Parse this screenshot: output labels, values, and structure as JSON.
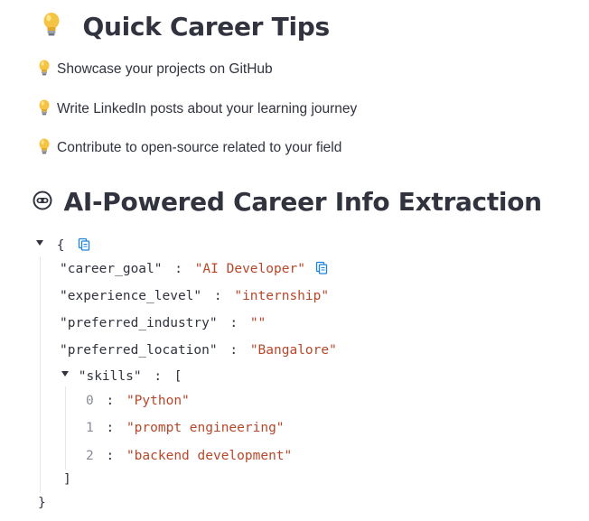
{
  "tips_section": {
    "title": "Quick Career Tips",
    "icon": "lightbulb-icon",
    "items": [
      "Showcase your projects on GitHub",
      "Write LinkedIn posts about your learning journey",
      "Contribute to open-source related to your field"
    ]
  },
  "extraction_section": {
    "title": "AI-Powered Career Info Extraction",
    "icon": "robot-face-icon"
  },
  "json_view": {
    "open_brace": "{",
    "close_brace": "}",
    "fields": [
      {
        "key": "\"career_goal\"",
        "value": "\"AI Developer\""
      },
      {
        "key": "\"experience_level\"",
        "value": "\"internship\""
      },
      {
        "key": "\"preferred_industry\"",
        "value": "\"\""
      },
      {
        "key": "\"preferred_location\"",
        "value": "\"Bangalore\""
      }
    ],
    "skills": {
      "key": "\"skills\"",
      "open_bracket": "[",
      "close_bracket": "]",
      "items": [
        {
          "index": "0",
          "value": "\"Python\""
        },
        {
          "index": "1",
          "value": "\"prompt engineering\""
        },
        {
          "index": "2",
          "value": "\"backend development\""
        }
      ]
    },
    "colon": ":",
    "colors": {
      "string": "#b7472a",
      "index": "#8a8d98",
      "copy_icon": "#1c83e1"
    }
  }
}
